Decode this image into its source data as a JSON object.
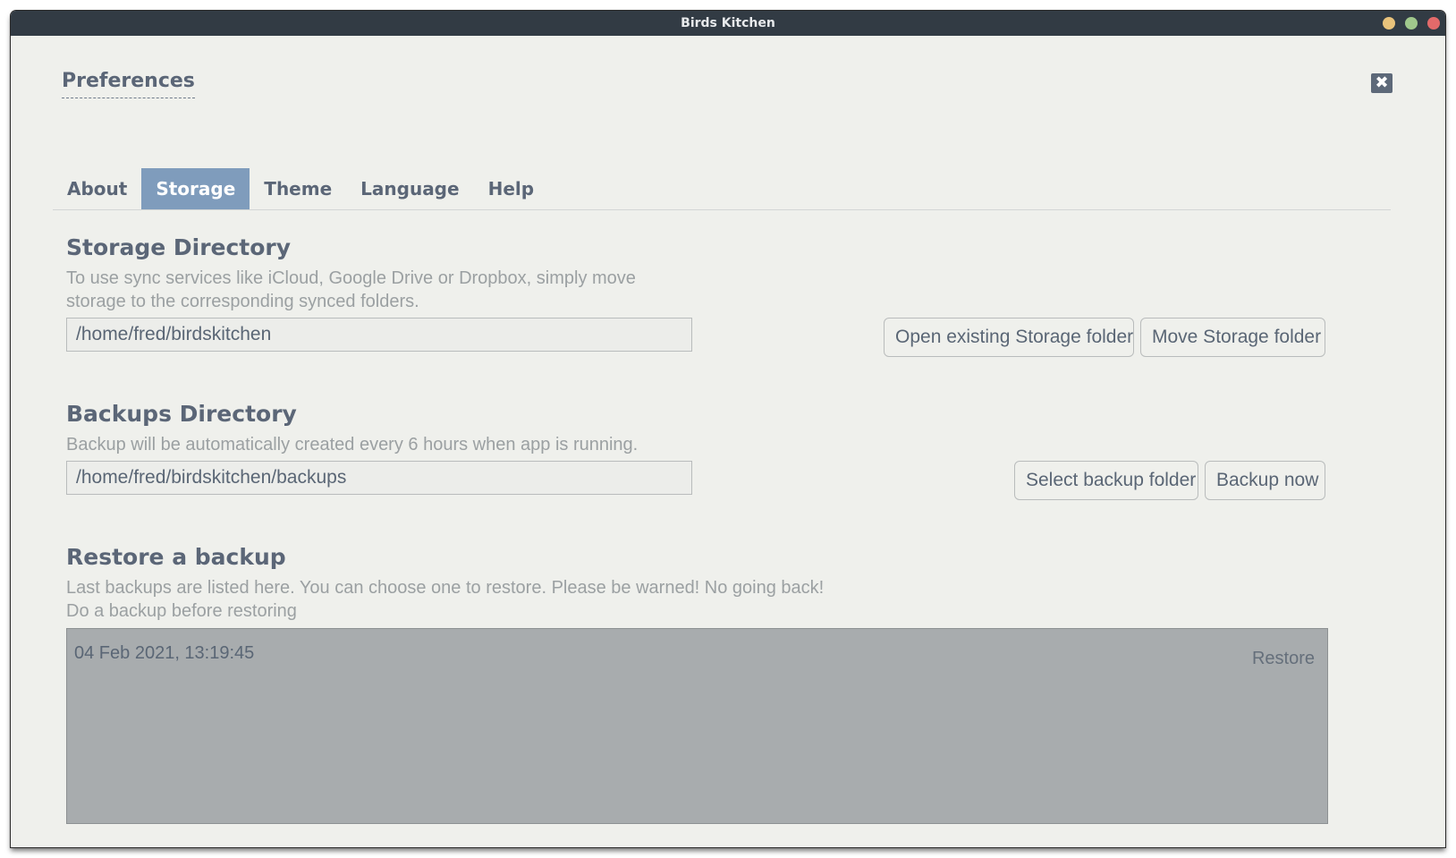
{
  "window": {
    "title": "Birds Kitchen"
  },
  "header": {
    "title": "Preferences",
    "close_icon": "close-icon"
  },
  "tabs": [
    {
      "label": "About",
      "active": false
    },
    {
      "label": "Storage",
      "active": true
    },
    {
      "label": "Theme",
      "active": false
    },
    {
      "label": "Language",
      "active": false
    },
    {
      "label": "Help",
      "active": false
    }
  ],
  "storage": {
    "title": "Storage Directory",
    "description_line1": "To use sync services like iCloud, Google Drive or Dropbox, simply move",
    "description_line2": "storage to the corresponding synced folders.",
    "path": "/home/fred/birdskitchen",
    "open_button": "Open existing Storage folder",
    "move_button": "Move Storage folder"
  },
  "backups": {
    "title": "Backups Directory",
    "description": "Backup will be automatically created every 6 hours when app is running.",
    "path": "/home/fred/birdskitchen/backups",
    "select_button": "Select backup folder",
    "backup_now_button": "Backup now"
  },
  "restore": {
    "title": "Restore a backup",
    "description_line1": "Last backups are listed here. You can choose one to restore. Please be warned! No going back!",
    "description_line2": "Do a backup before restoring",
    "items": [
      {
        "date": "04 Feb 2021, 13:19:45",
        "action": "Restore"
      }
    ]
  },
  "colors": {
    "titlebar": "#323b44",
    "accent_tab": "#7f9cbc",
    "background": "#eff0ec",
    "list_background": "#a8acae"
  }
}
